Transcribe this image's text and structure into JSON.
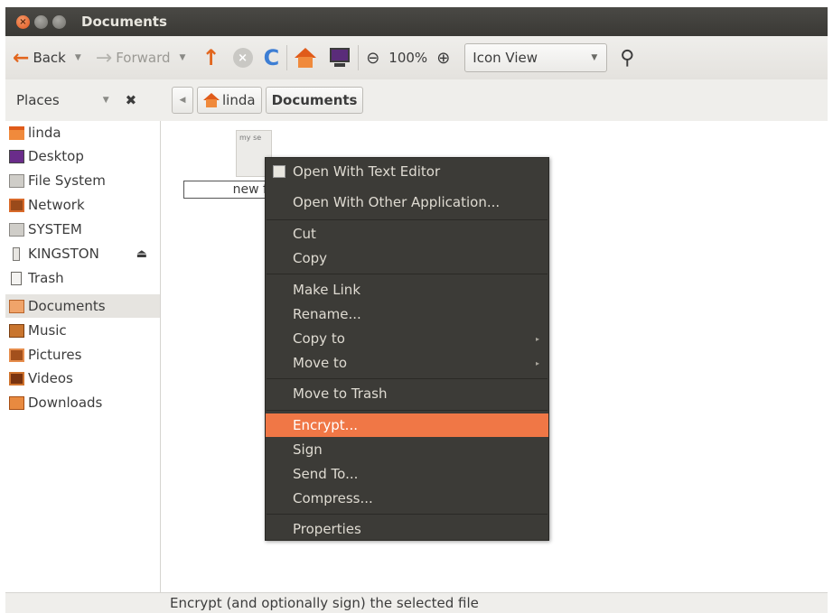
{
  "window": {
    "title": "Documents"
  },
  "toolbar": {
    "back_label": "Back",
    "forward_label": "Forward",
    "zoom_level": "100%",
    "view_mode": "Icon View"
  },
  "sidebar": {
    "header": "Places",
    "items": [
      {
        "label": "linda",
        "icon": "home-folder-icon"
      },
      {
        "label": "Desktop",
        "icon": "desktop-icon"
      },
      {
        "label": "File System",
        "icon": "drive-icon"
      },
      {
        "label": "Network",
        "icon": "network-icon"
      },
      {
        "label": "SYSTEM",
        "icon": "drive-icon"
      },
      {
        "label": "KINGSTON",
        "icon": "usb-drive-icon"
      },
      {
        "label": "Trash",
        "icon": "trash-icon"
      },
      {
        "label": "Documents",
        "icon": "documents-folder-icon",
        "selected": true
      },
      {
        "label": "Music",
        "icon": "music-folder-icon"
      },
      {
        "label": "Pictures",
        "icon": "pictures-folder-icon"
      },
      {
        "label": "Videos",
        "icon": "videos-folder-icon"
      },
      {
        "label": "Downloads",
        "icon": "downloads-folder-icon"
      }
    ]
  },
  "pathbar": {
    "home": "linda",
    "current": "Documents"
  },
  "file": {
    "name": "new f",
    "preview_text": "my se"
  },
  "context_menu": {
    "items": [
      {
        "label": "Open With Text Editor"
      },
      {
        "label": "Open With Other Application..."
      },
      {
        "label": "Cut"
      },
      {
        "label": "Copy"
      },
      {
        "label": "Make Link"
      },
      {
        "label": "Rename..."
      },
      {
        "label": "Copy to",
        "submenu": true
      },
      {
        "label": "Move to",
        "submenu": true
      },
      {
        "label": "Move to Trash"
      },
      {
        "label": "Encrypt...",
        "active": true
      },
      {
        "label": "Sign"
      },
      {
        "label": "Send To..."
      },
      {
        "label": "Compress..."
      },
      {
        "label": "Properties"
      }
    ]
  },
  "status": {
    "text": "Encrypt (and optionally sign) the selected file"
  },
  "colors": {
    "accent": "#f07746",
    "menu_bg": "#3c3b37",
    "titlebar": "#3c3b37"
  }
}
